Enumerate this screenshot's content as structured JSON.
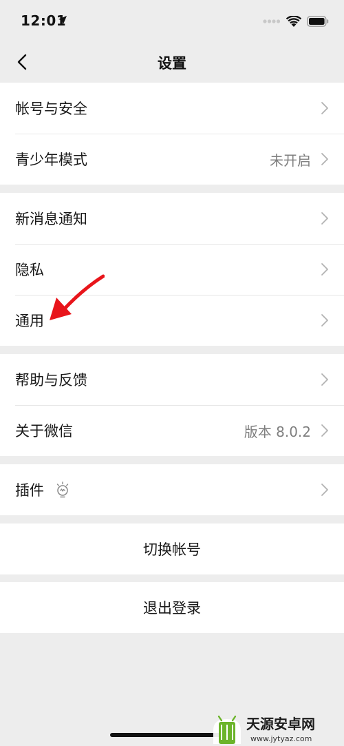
{
  "status_bar": {
    "time": "12:01",
    "icons": [
      "location-arrow-icon",
      "signal-dots-icon",
      "wifi-icon",
      "battery-icon"
    ]
  },
  "nav": {
    "title": "设置",
    "back_icon": "chevron-left-icon"
  },
  "groups": [
    {
      "items": [
        {
          "label": "帐号与安全",
          "value": ""
        },
        {
          "label": "青少年模式",
          "value": "未开启"
        }
      ]
    },
    {
      "items": [
        {
          "label": "新消息通知",
          "value": ""
        },
        {
          "label": "隐私",
          "value": ""
        },
        {
          "label": "通用",
          "value": ""
        }
      ]
    },
    {
      "items": [
        {
          "label": "帮助与反馈",
          "value": ""
        },
        {
          "label": "关于微信",
          "value": "版本 8.0.2"
        }
      ]
    },
    {
      "items": [
        {
          "label": "插件",
          "value": "",
          "icon": "lightbulb-icon"
        }
      ]
    }
  ],
  "actions": {
    "switch_account": "切换帐号",
    "logout": "退出登录"
  },
  "colors": {
    "background": "#ededed",
    "panel": "#ffffff",
    "divider": "#e6e6e6",
    "secondary_text": "#7f7f7f",
    "annotation": "#e8151b"
  },
  "watermark": {
    "brand": "天源安卓网",
    "url": "www.jytyaz.com"
  }
}
